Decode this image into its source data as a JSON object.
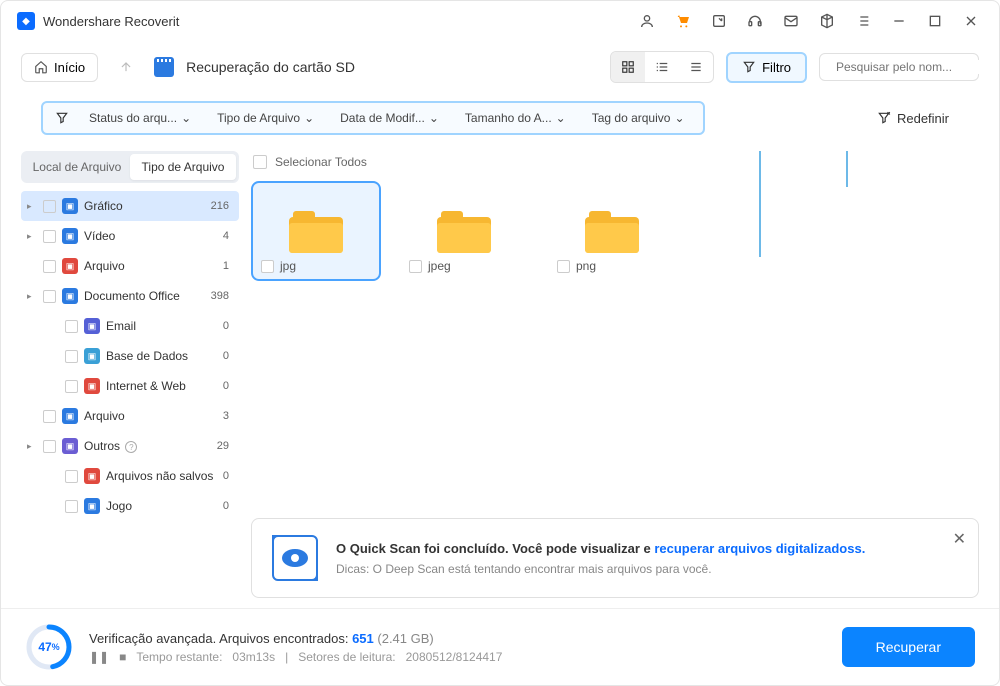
{
  "app": {
    "title": "Wondershare Recoverit"
  },
  "toolbar": {
    "home": "Início",
    "breadcrumb": "Recuperação do cartão SD",
    "filter": "Filtro",
    "search_placeholder": "Pesquisar pelo nom..."
  },
  "filters": {
    "status": "Status do arqu...",
    "type": "Tipo de Arquivo",
    "modified": "Data de Modif...",
    "size": "Tamanho do A...",
    "tag": "Tag do arquivo",
    "reset": "Redefinir"
  },
  "sidebar": {
    "tab_location": "Local de Arquivo",
    "tab_type": "Tipo de Arquivo",
    "items": [
      {
        "label": "Gráfico",
        "count": "216",
        "color": "#2b7ae0",
        "selected": true,
        "arrow": true
      },
      {
        "label": "Vídeo",
        "count": "4",
        "color": "#2b7ae0",
        "arrow": true
      },
      {
        "label": "Arquivo",
        "count": "1",
        "color": "#e0493e"
      },
      {
        "label": "Documento Office",
        "count": "398",
        "color": "#2b7ae0",
        "arrow": true
      },
      {
        "label": "Email",
        "count": "0",
        "color": "#5560d6",
        "child": true
      },
      {
        "label": "Base de Dados",
        "count": "0",
        "color": "#3aa0d6",
        "child": true
      },
      {
        "label": "Internet & Web",
        "count": "0",
        "color": "#e0493e",
        "child": true
      },
      {
        "label": "Arquivo",
        "count": "3",
        "color": "#2b7ae0"
      },
      {
        "label": "Outros",
        "count": "29",
        "color": "#6b5dd3",
        "arrow": true,
        "help": true
      },
      {
        "label": "Arquivos não salvos",
        "count": "0",
        "color": "#e0493e",
        "child": true
      },
      {
        "label": "Jogo",
        "count": "0",
        "color": "#2b7ae0",
        "child": true
      }
    ]
  },
  "content": {
    "select_all": "Selecionar Todos",
    "folders": [
      {
        "label": "jpg",
        "selected": true
      },
      {
        "label": "jpeg"
      },
      {
        "label": "png"
      }
    ]
  },
  "notice": {
    "line1a": "O Quick Scan foi concluído. Você pode visualizar e ",
    "link": "recuperar arquivos digitalizadoss.",
    "line2": "Dicas: O Deep Scan está tentando encontrar mais arquivos para você."
  },
  "footer": {
    "progress_pct": "47",
    "title": "Verificação avançada. Arquivos encontrados: ",
    "found": "651",
    "size": "(2.41 GB)",
    "time_label": "Tempo restante:",
    "time_value": "03m13s",
    "sectors_label": "Setores de leitura:",
    "sectors_value": "2080512/8124417",
    "recover": "Recuperar"
  }
}
